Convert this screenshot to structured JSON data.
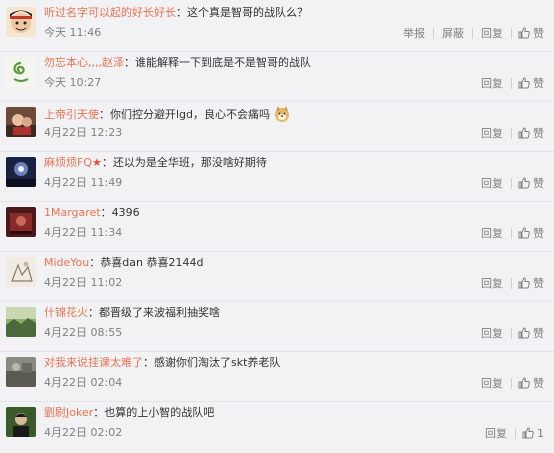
{
  "comments": [
    {
      "user": "听过名字可以起的好长好长",
      "text": "这个真是智哥的战队么？",
      "time": "今天 11:46",
      "actions": [
        "举报",
        "屏蔽",
        "回复"
      ],
      "like": "赞",
      "avatar": "anime-character"
    },
    {
      "user": "勿忘本心,,,,赵泽",
      "text": "谁能解释一下到底是不是智哥的战队",
      "time": "今天 10:27",
      "actions": [
        "回复"
      ],
      "like": "赞",
      "avatar": "green-swirl"
    },
    {
      "user": "上帝引天使",
      "text": "你们控分避开lgd，良心不会痛吗",
      "time": "4月22日 12:23",
      "actions": [
        "回复"
      ],
      "like": "赞",
      "avatar": "photo",
      "emoji": "doge-emoji"
    },
    {
      "user": "麻烦烦FQ",
      "text": "还以为是全华班，那没啥好期待",
      "time": "4月22日 11:49",
      "actions": [
        "回复"
      ],
      "like": "赞",
      "avatar": "night-scene",
      "badge": "★"
    },
    {
      "user": "1Margaret",
      "text": "4396",
      "time": "4月22日 11:34",
      "actions": [
        "回复"
      ],
      "like": "赞",
      "avatar": "dark-red"
    },
    {
      "user": "MideYou",
      "text": "恭喜dan 恭喜2144d",
      "time": "4月22日 11:02",
      "actions": [
        "回复"
      ],
      "like": "赞",
      "avatar": "sketch"
    },
    {
      "user": "什锦花火",
      "text": "都晋级了来波福利抽奖啥",
      "time": "4月22日 08:55",
      "actions": [
        "回复"
      ],
      "like": "赞",
      "avatar": "landscape"
    },
    {
      "user": "对我来说挂课太难了",
      "text": "感谢你们淘汰了skt养老队",
      "time": "4月22日 02:04",
      "actions": [
        "回复"
      ],
      "like": "赞",
      "avatar": "gray-photo"
    },
    {
      "user": "劉尉Joker",
      "text": "也算的上小智的战队吧",
      "time": "4月22日 02:02",
      "actions": [
        "回复"
      ],
      "like": "1",
      "avatar": "person"
    }
  ]
}
